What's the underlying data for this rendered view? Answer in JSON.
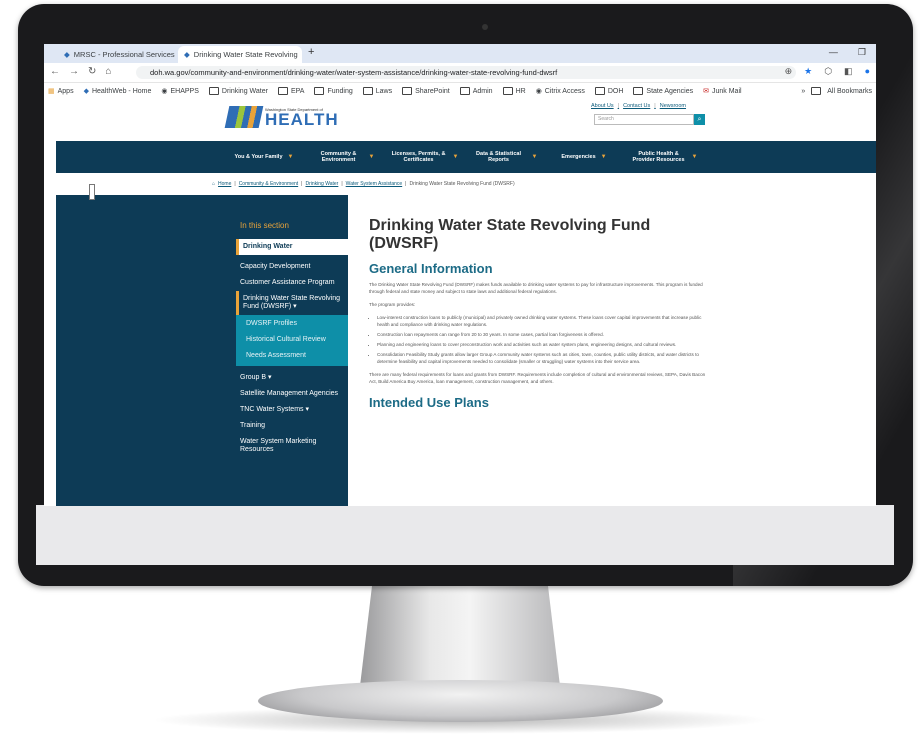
{
  "browser": {
    "tabs": [
      {
        "label": "MRSC - Professional Services C",
        "active": false
      },
      {
        "label": "Drinking Water State Revolving",
        "active": true
      }
    ],
    "url": "doh.wa.gov/community-and-environment/drinking-water/water-system-assistance/drinking-water-state-revolving-fund-dwsrf",
    "bookmarks": [
      "Apps",
      "HealthWeb - Home",
      "EHAPPS",
      "Drinking Water",
      "EPA",
      "Funding",
      "Laws",
      "SharePoint",
      "Admin",
      "HR",
      "Citrix Access",
      "DOH",
      "State Agencies",
      "Junk Mail"
    ],
    "bookmarks_right": "All Bookmarks"
  },
  "site": {
    "logo_small": "Washington State Department of",
    "logo_big": "HEALTH",
    "top_links": [
      "About Us",
      "Contact Us",
      "Newsroom"
    ],
    "search_placeholder": "Search",
    "nav": [
      "You & Your Family",
      "Community & Environment",
      "Licenses, Permits, & Certificates",
      "Data & Statistical Reports",
      "Emergencies",
      "Public Health & Provider Resources"
    ],
    "breadcrumb": [
      "Home",
      "Community & Environment",
      "Drinking Water",
      "Water System Assistance",
      "Drinking Water State Revolving Fund (DWSRF)"
    ]
  },
  "sidebar": {
    "title": "In this section",
    "items": [
      {
        "label": "Drinking Water"
      },
      {
        "label": "Capacity Development"
      },
      {
        "label": "Customer Assistance Program"
      },
      {
        "label": "Drinking Water State Revolving Fund (DWSRF) ▾"
      },
      {
        "label": "DWSRF Profiles"
      },
      {
        "label": "Historical Cultural Review"
      },
      {
        "label": "Needs Assessment"
      },
      {
        "label": "Group B ▾"
      },
      {
        "label": "Satellite Management Agencies"
      },
      {
        "label": "TNC Water Systems ▾"
      },
      {
        "label": "Training"
      },
      {
        "label": "Water System Marketing Resources"
      }
    ]
  },
  "content": {
    "title": "Drinking Water State Revolving Fund (DWSRF)",
    "general_heading": "General Information",
    "intro": "The Drinking Water State Revolving Fund (DWSRF) makes funds available to drinking water systems to pay for infrastructure improvements. This program is funded through federal and state money and subject to state laws and additional federal regulations.",
    "provides": "The program provides:",
    "bullets": [
      "Low-interest construction loans to publicly (municipal) and privately owned drinking water systems. These loans cover capital improvements that increase public health and compliance with drinking water regulations.",
      "Construction loan repayments can range from 20 to 30 years. In some cases, partial loan forgiveness is offered.",
      "Planning and engineering loans to cover preconstruction work and activities such as water system plans, engineering designs, and cultural reviews.",
      "Consolidation Feasibility Study grants allow larger Group A community water systems such as cities, town, counties, public utility districts, and water districts to determine feasibility and capital improvements needed to consolidate (smaller or struggling) water systems into their service area."
    ],
    "requirements": "There are many federal requirements for loans and grants from DWSRF. Requirements include completion of cultural and environmental reviews, SEPA, Davis Bacon Act, Build America Buy America, loan management, construction management, and others.",
    "plans_heading": "Intended Use Plans"
  }
}
